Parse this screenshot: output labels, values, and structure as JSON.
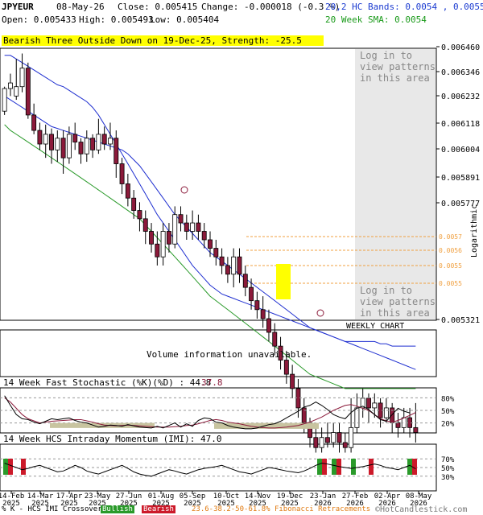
{
  "header": {
    "symbol": "JPYEUR",
    "date": "08-May-26",
    "close": "Close: 0.005415",
    "change": "Change: -0.000018 (-0.3 %)",
    "bands": "20,2 HC Bands: 0.0054 , 0.0055",
    "open": "Open: 0.005433",
    "high": "High: 0.005493",
    "low": "Low: 0.005404",
    "sma": "20 Week SMA: 0.0054"
  },
  "signal": "Bearish Three Outside Down on 19-Dec-25, Strength: -25.5",
  "login_text_1": [
    "Log in to",
    "view patterns",
    "in this area"
  ],
  "login_text_2": [
    "Log in to",
    "view patterns",
    "in this area"
  ],
  "weekly_label": "WEEKLY CHART",
  "volume_text": "Volume information unavailable.",
  "price_axis_title": "Logarithmic",
  "stoch_title": "14 Week Fast Stochastic (%K)(%D) : 44.8",
  "stoch_d_value": "37.8",
  "imi_title": "14 Week HCS Intraday Momentum (IMI): 47.0",
  "footer": {
    "crossover": "% K - HCS IMI Crossover:",
    "bullish": "Bullish",
    "bearish": "Bearish",
    "fib": "23.6-38.2-50-61.8% Fibonacci Retracements",
    "brand": "©HotCandlestick.com"
  },
  "colors": {
    "bull": "#ffffff",
    "bear": "#8b1a3a",
    "upper_band": "#1f2fd0",
    "sma": "#2a9a2a",
    "fib": "#f0a040",
    "highlight": "#ffff00",
    "login_bg": "#e8e8e8",
    "oversold_fill": "#c8c4a0"
  },
  "chart_data": [
    {
      "type": "candlestick",
      "y_scale": "log",
      "ylim": [
        0.00532,
        0.00665
      ],
      "y_ticks": [
        "0.006460",
        "0.006346",
        "0.006232",
        "0.006118",
        "0.006004",
        "0.005891",
        "0.005777",
        "0.005321"
      ],
      "fib_labels": [
        "0.0057",
        "0.0056",
        "0.0055",
        "0.0055"
      ],
      "fib_levels": [
        0.00569,
        0.00562,
        0.00555,
        0.00546
      ],
      "x_tick_labels": [
        [
          "14-Feb",
          "2025"
        ],
        [
          "14-Mar",
          "2025"
        ],
        [
          "17-Apr",
          "2025"
        ],
        [
          "23-May",
          "2025"
        ],
        [
          "27-Jun",
          "2025"
        ],
        [
          "01-Aug",
          "2025"
        ],
        [
          "05-Sep",
          "2025"
        ],
        [
          "10-Oct",
          "2025"
        ],
        [
          "14-Nov",
          "2025"
        ],
        [
          "19-Dec",
          "2025"
        ],
        [
          "23-Jan",
          "2026"
        ],
        [
          "27-Feb",
          "2026"
        ],
        [
          "02-Apr",
          "2026"
        ],
        [
          "08-May",
          "2026"
        ]
      ],
      "candles": [
        [
          0.00632,
          0.00644,
          0.00645,
          0.0063
        ],
        [
          0.00644,
          0.00647,
          0.00652,
          0.0064
        ],
        [
          0.0064,
          0.00645,
          0.0066,
          0.00638
        ],
        [
          0.00645,
          0.00655,
          0.00663,
          0.00642
        ],
        [
          0.00655,
          0.0063,
          0.00658,
          0.00628
        ],
        [
          0.0063,
          0.00622,
          0.00636,
          0.0062
        ],
        [
          0.00622,
          0.00615,
          0.00626,
          0.00612
        ],
        [
          0.00615,
          0.0062,
          0.00625,
          0.00608
        ],
        [
          0.0062,
          0.00612,
          0.00623,
          0.00605
        ],
        [
          0.00612,
          0.00618,
          0.00622,
          0.00606
        ],
        [
          0.00618,
          0.00608,
          0.00622,
          0.006
        ],
        [
          0.00608,
          0.0062,
          0.00624,
          0.00605
        ],
        [
          0.0062,
          0.00616,
          0.00626,
          0.00612
        ],
        [
          0.00616,
          0.0061,
          0.00618,
          0.00605
        ],
        [
          0.0061,
          0.00618,
          0.00622,
          0.00606
        ],
        [
          0.00618,
          0.00612,
          0.0062,
          0.00608
        ],
        [
          0.00612,
          0.0062,
          0.00628,
          0.0061
        ],
        [
          0.0062,
          0.00615,
          0.00624,
          0.00612
        ],
        [
          0.00615,
          0.00618,
          0.00626,
          0.00612
        ],
        [
          0.00618,
          0.00605,
          0.00622,
          0.00598
        ],
        [
          0.00605,
          0.00595,
          0.00608,
          0.0059
        ],
        [
          0.00595,
          0.00588,
          0.006,
          0.00584
        ],
        [
          0.00588,
          0.00582,
          0.00592,
          0.00578
        ],
        [
          0.00582,
          0.00578,
          0.00586,
          0.00572
        ],
        [
          0.00578,
          0.00572,
          0.00582,
          0.00566
        ],
        [
          0.00572,
          0.00566,
          0.00576,
          0.00562
        ],
        [
          0.00566,
          0.0056,
          0.00572,
          0.00556
        ],
        [
          0.0056,
          0.00572,
          0.00576,
          0.00556
        ],
        [
          0.00572,
          0.00566,
          0.00576,
          0.00562
        ],
        [
          0.00566,
          0.0058,
          0.00584,
          0.00564
        ],
        [
          0.0058,
          0.00576,
          0.00584,
          0.00572
        ],
        [
          0.00576,
          0.00572,
          0.0058,
          0.00568
        ],
        [
          0.00572,
          0.00576,
          0.00582,
          0.00568
        ],
        [
          0.00576,
          0.00572,
          0.0058,
          0.00568
        ],
        [
          0.00572,
          0.00568,
          0.00576,
          0.00564
        ],
        [
          0.00568,
          0.00564,
          0.00572,
          0.0056
        ],
        [
          0.00564,
          0.0056,
          0.00568,
          0.00556
        ],
        [
          0.0056,
          0.00556,
          0.00564,
          0.00552
        ],
        [
          0.00556,
          0.00552,
          0.0056,
          0.00548
        ],
        [
          0.00552,
          0.0056,
          0.00564,
          0.00546
        ],
        [
          0.0056,
          0.00552,
          0.00564,
          0.00548
        ],
        [
          0.00552,
          0.00546,
          0.00556,
          0.00542
        ],
        [
          0.00546,
          0.0054,
          0.0055,
          0.00536
        ],
        [
          0.0054,
          0.00536,
          0.00544,
          0.00532
        ],
        [
          0.00536,
          0.00532,
          0.00542,
          0.00528
        ],
        [
          0.00532,
          0.00526,
          0.00536,
          0.00522
        ],
        [
          0.00526,
          0.0052,
          0.0053,
          0.00516
        ],
        [
          0.0052,
          0.00514,
          0.00524,
          0.0051
        ],
        [
          0.00514,
          0.00508,
          0.00518,
          0.00504
        ],
        [
          0.00508,
          0.00502,
          0.00512,
          0.00498
        ],
        [
          0.00502,
          0.00494,
          0.00506,
          0.0049
        ],
        [
          0.00494,
          0.00488,
          0.00498,
          0.00484
        ],
        [
          0.00488,
          0.00482,
          0.0049,
          0.00478
        ],
        [
          0.00482,
          0.00478,
          0.00486,
          0.00476
        ],
        [
          0.00478,
          0.00482,
          0.00486,
          0.00476
        ],
        [
          0.00482,
          0.0048,
          0.00488,
          0.00478
        ],
        [
          0.0048,
          0.00484,
          0.00488,
          0.00478
        ],
        [
          0.00484,
          0.0048,
          0.00488,
          0.00476
        ],
        [
          0.0048,
          0.00478,
          0.00484,
          0.00476
        ],
        [
          0.00478,
          0.00486,
          0.00498,
          0.00476
        ],
        [
          0.00486,
          0.00494,
          0.005,
          0.00484
        ],
        [
          0.00494,
          0.00498,
          0.00502,
          0.0049
        ],
        [
          0.00498,
          0.00494,
          0.005,
          0.00488
        ],
        [
          0.00494,
          0.00496,
          0.005,
          0.0049
        ],
        [
          0.00496,
          0.0049,
          0.00498,
          0.00486
        ],
        [
          0.0049,
          0.00494,
          0.00498,
          0.00488
        ],
        [
          0.00494,
          0.00488,
          0.00496,
          0.00484
        ],
        [
          0.00488,
          0.00486,
          0.00492,
          0.00482
        ],
        [
          0.00486,
          0.0049,
          0.00494,
          0.00484
        ],
        [
          0.0049,
          0.00486,
          0.00494,
          0.00482
        ],
        [
          0.00486,
          0.00484,
          0.00496,
          0.0048
        ]
      ],
      "series": [
        {
          "values": [
            0.0064,
            0.00638,
            0.00636,
            0.00634,
            0.00632,
            0.0063,
            0.00628,
            0.00626,
            0.00624,
            0.00623,
            0.00622,
            0.00621,
            0.0062,
            0.00619,
            0.00618,
            0.00617,
            0.00616,
            0.00615,
            0.00614,
            0.00613,
            0.00612,
            0.0061,
            0.00607,
            0.00604,
            0.006,
            0.00596,
            0.00592,
            0.00588,
            0.00584,
            0.0058,
            0.00577,
            0.00574,
            0.00571,
            0.00568,
            0.00565,
            0.00562,
            0.0056,
            0.00558,
            0.00556,
            0.00554,
            0.00552,
            0.0055,
            0.00548,
            0.00546,
            0.00544,
            0.00542,
            0.0054,
            0.00538,
            0.00536,
            0.00534,
            0.00532,
            0.0053,
            0.00528,
            0.00527,
            0.00526,
            0.00525,
            0.00524,
            0.00523,
            0.00522,
            0.00521,
            0.0052,
            0.00519,
            0.00518,
            0.00517,
            0.00516,
            0.00515,
            0.00514,
            0.00513,
            0.00512,
            0.00511,
            0.0051
          ]
        },
        {
          "values": [
            0.00662,
            0.00662,
            0.0066,
            0.00658,
            0.00656,
            0.00654,
            0.00652,
            0.0065,
            0.00648,
            0.00646,
            0.00645,
            0.00643,
            0.00641,
            0.00639,
            0.00637,
            0.00634,
            0.0063,
            0.00625,
            0.0062,
            0.00615,
            0.0061,
            0.00605,
            0.006,
            0.00595,
            0.0059,
            0.00585,
            0.0058,
            0.00576,
            0.00572,
            0.00568,
            0.00564,
            0.0056,
            0.00556,
            0.00553,
            0.0055,
            0.00547,
            0.00545,
            0.00543,
            0.00542,
            0.00541,
            0.0054,
            0.00539,
            0.00538,
            0.00537,
            0.00536,
            0.00535,
            0.00534,
            0.00533,
            0.00532,
            0.00531,
            0.0053,
            0.00529,
            0.00528,
            0.00527,
            0.00526,
            0.00525,
            0.00524,
            0.00523,
            0.00522,
            0.00522,
            0.00522,
            0.00522,
            0.00522,
            0.00522,
            0.00521,
            0.00521,
            0.0052,
            0.0052,
            0.0052,
            0.0052,
            0.0052
          ]
        },
        {
          "values": [
            0.00625,
            0.00622,
            0.0062,
            0.00618,
            0.00616,
            0.00614,
            0.00612,
            0.0061,
            0.00608,
            0.00606,
            0.00604,
            0.00602,
            0.006,
            0.00598,
            0.00596,
            0.00594,
            0.00592,
            0.0059,
            0.00588,
            0.00586,
            0.00584,
            0.00582,
            0.0058,
            0.00578,
            0.00575,
            0.00572,
            0.00569,
            0.00566,
            0.00563,
            0.0056,
            0.00557,
            0.00554,
            0.00551,
            0.00548,
            0.00545,
            0.00542,
            0.0054,
            0.00538,
            0.00536,
            0.00534,
            0.00532,
            0.0053,
            0.00528,
            0.00526,
            0.00524,
            0.00522,
            0.0052,
            0.00518,
            0.00516,
            0.00514,
            0.00512,
            0.0051,
            0.00508,
            0.00507,
            0.00506,
            0.00505,
            0.00504,
            0.00503,
            0.00502,
            0.00502,
            0.00502,
            0.00502,
            0.00502,
            0.00502,
            0.00502,
            0.00502,
            0.00502,
            0.00502,
            0.00502,
            0.00502,
            0.00502
          ]
        }
      ]
    },
    {
      "type": "line",
      "ylim": [
        0,
        100
      ],
      "y_ticks": [
        "80%",
        "50%",
        "20%"
      ],
      "series": [
        {
          "values": [
            80,
            70,
            55,
            40,
            30,
            25,
            20,
            22,
            24,
            25,
            26,
            27,
            28,
            28,
            25,
            22,
            18,
            15,
            14,
            13,
            14,
            15,
            14,
            13,
            12,
            11,
            10,
            10,
            10,
            11,
            12,
            14,
            15,
            18,
            22,
            26,
            28,
            26,
            22,
            20,
            18,
            15,
            12,
            10,
            9,
            8,
            8,
            9,
            10,
            12,
            14,
            18,
            22,
            28,
            34,
            42,
            50,
            56,
            62,
            64,
            60,
            55,
            50,
            40,
            30,
            25,
            22,
            26,
            32,
            38,
            45
          ]
        },
        {
          "values": [
            85,
            62,
            40,
            30,
            28,
            22,
            18,
            24,
            30,
            28,
            30,
            32,
            26,
            22,
            20,
            15,
            10,
            12,
            15,
            14,
            12,
            16,
            13,
            10,
            9,
            8,
            12,
            8,
            14,
            20,
            10,
            18,
            12,
            26,
            32,
            30,
            22,
            20,
            14,
            10,
            8,
            6,
            6,
            8,
            12,
            16,
            18,
            24,
            32,
            40,
            48,
            58,
            62,
            70,
            62,
            52,
            40,
            34,
            30,
            45,
            55,
            60,
            52,
            40,
            28,
            24,
            40,
            55,
            48,
            44
          ]
        }
      ]
    },
    {
      "type": "line",
      "ylim": [
        0,
        100
      ],
      "y_ticks": [
        "70%",
        "50%",
        "30%"
      ],
      "series": [
        {
          "values": [
            60,
            55,
            50,
            45,
            48,
            52,
            55,
            50,
            45,
            40,
            42,
            48,
            55,
            50,
            42,
            38,
            35,
            40,
            45,
            50,
            55,
            48,
            40,
            35,
            32,
            30,
            35,
            40,
            45,
            42,
            38,
            35,
            40,
            45,
            48,
            50,
            52,
            55,
            50,
            45,
            40,
            38,
            35,
            40,
            45,
            50,
            48,
            45,
            42,
            40,
            38,
            42,
            48,
            55,
            60,
            58,
            55,
            52,
            50,
            48,
            50,
            52,
            55,
            58,
            55,
            50,
            48,
            45,
            50,
            55,
            47
          ]
        }
      ]
    }
  ]
}
